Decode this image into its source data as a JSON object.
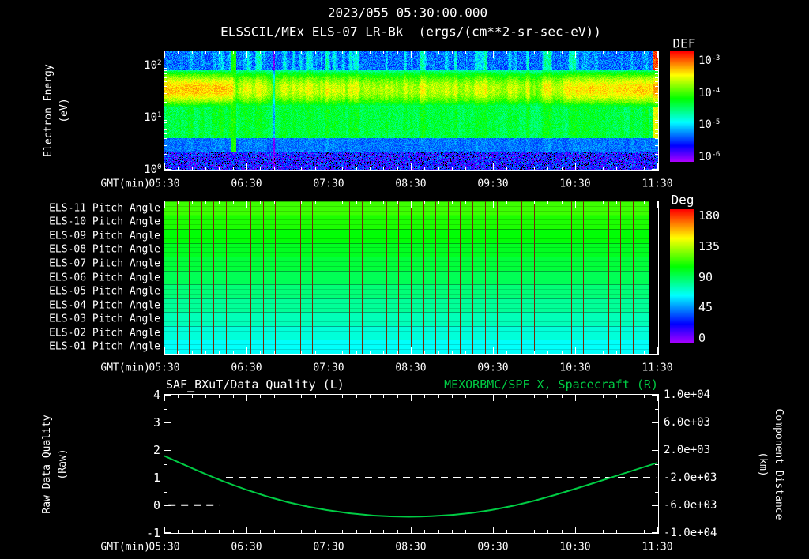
{
  "header": {
    "datetime": "2023/055 05:30:00.000",
    "instrument": "ELSSCIL/MEx ELS-07 LR-Bk",
    "units": "(ergs/(cm**2-sr-sec-eV))"
  },
  "colors": {
    "background": "#000000",
    "text": "#ffffff",
    "accent_green": "#00cc44",
    "grid_red": "#78280a",
    "frame": "#ffffff"
  },
  "time_axis": {
    "label": "GMT(min)",
    "ticks": [
      "05:30",
      "06:30",
      "07:30",
      "08:30",
      "09:30",
      "10:30",
      "11:30"
    ],
    "start": "05:30",
    "end": "11:30",
    "span_minutes": 360
  },
  "panel_energy": {
    "ylabel_line1": "Electron Energy",
    "ylabel_line2": "(eV)",
    "y_ticks": [
      {
        "base": "10",
        "exp": "2"
      },
      {
        "base": "10",
        "exp": "1"
      },
      {
        "base": "10",
        "exp": "0"
      }
    ],
    "colorbar": {
      "title": "DEF",
      "ticks": [
        {
          "base": "10",
          "exp": "-3"
        },
        {
          "base": "10",
          "exp": "-4"
        },
        {
          "base": "10",
          "exp": "-5"
        },
        {
          "base": "10",
          "exp": "-6"
        }
      ]
    }
  },
  "panel_pitch": {
    "row_labels": [
      "ELS-11 Pitch Angle",
      "ELS-10 Pitch Angle",
      "ELS-09 Pitch Angle",
      "ELS-08 Pitch Angle",
      "ELS-07 Pitch Angle",
      "ELS-06 Pitch Angle",
      "ELS-05 Pitch Angle",
      "ELS-04 Pitch Angle",
      "ELS-03 Pitch Angle",
      "ELS-02 Pitch Angle",
      "ELS-01 Pitch Angle"
    ],
    "colorbar": {
      "title": "Deg",
      "ticks": [
        "180",
        "135",
        "90",
        "45",
        "0"
      ]
    }
  },
  "panel_line": {
    "title_left": "SAF_BXuT/Data Quality (L)",
    "title_right": "MEXORBMC/SPF X, Spacecraft (R)",
    "ylabel_left_line1": "Raw Data Quality",
    "ylabel_left_line2": "(Raw)",
    "ylabel_right_line1": "Component Distance",
    "ylabel_right_line2": "(km)",
    "left_ticks": [
      "4",
      "3",
      "2",
      "1",
      "0",
      "-1"
    ],
    "right_ticks": [
      "1.0e+04",
      "6.0e+03",
      "2.0e+03",
      "-2.0e+03",
      "-6.0e+03",
      "-1.0e+04"
    ]
  },
  "chart_data": [
    {
      "type": "heatmap",
      "name": "electron_energy_spectrogram",
      "title": "ELSSCIL/MEx ELS-07 LR-Bk",
      "value_units": "ergs/(cm**2-sr-sec-eV)",
      "xlabel": "GMT(min)",
      "ylabel": "Electron Energy (eV)",
      "x_range": [
        "05:30",
        "11:30"
      ],
      "y_range_ev": [
        1,
        200
      ],
      "y_scale": "log",
      "color_scale_log10": [
        -6,
        -3
      ],
      "colorbar_label": "DEF",
      "bands": [
        {
          "energy_ev": [
            16,
            80
          ],
          "log10_flux": -3.6,
          "description": "bright yellow-green peak band"
        },
        {
          "energy_ev": [
            4,
            16
          ],
          "log10_flux": -4.6,
          "description": "green/cyan mottled flux"
        },
        {
          "energy_ev": [
            2.3,
            4
          ],
          "log10_flux": -5.3,
          "description": "dark blue band"
        },
        {
          "energy_ev": [
            1,
            2.3
          ],
          "log10_flux": -5.6,
          "description": "purple speckled background with black dropouts"
        },
        {
          "energy_ev": [
            80,
            200
          ],
          "log10_flux": -5.3,
          "description": "blue region with vertical green striations"
        }
      ],
      "time_features": [
        {
          "gmt": [
            "05:30",
            "06:20"
          ],
          "description": "intense yellow band 20-70 eV"
        },
        {
          "gmt": [
            "06:20",
            "10:20"
          ],
          "description": "variable flux, vertical green striations and dark gaps"
        },
        {
          "gmt": [
            "10:20",
            "11:30"
          ],
          "description": "band brightens again"
        },
        {
          "gmt": [
            "11:26",
            "11:30"
          ],
          "description": "intense full-height column, red above 100 eV"
        }
      ]
    },
    {
      "type": "heatmap",
      "name": "pitch_angle_panels",
      "xlabel": "GMT(min)",
      "rows": [
        "ELS-11",
        "ELS-10",
        "ELS-09",
        "ELS-08",
        "ELS-07",
        "ELS-06",
        "ELS-05",
        "ELS-04",
        "ELS-03",
        "ELS-02",
        "ELS-01"
      ],
      "row_pitch_angle_deg": [
        112,
        107,
        102,
        98,
        94,
        90,
        85,
        80,
        75,
        70,
        65
      ],
      "color_scale_deg": [
        0,
        180
      ],
      "colorbar_label": "Deg",
      "data_gap_t_min": [
        353,
        360
      ]
    },
    {
      "type": "line",
      "name": "data_quality_and_spacecraft_x",
      "xlabel": "GMT(min)",
      "left_axis": {
        "label": "Raw Data Quality (Raw)",
        "range": [
          -1,
          4
        ]
      },
      "right_axis": {
        "label": "Component Distance (km)",
        "range": [
          -10000,
          10000
        ]
      },
      "series": [
        {
          "name": "SAF_BXuT/Data Quality (L)",
          "axis": "left",
          "style": "dashed",
          "color": "#ffffff",
          "segments": [
            {
              "t_min": [
                3,
                40
              ],
              "value": 0
            },
            {
              "t_min": [
                45,
                359
              ],
              "value": 1
            }
          ]
        },
        {
          "name": "MEXORBMC/SPF X, Spacecraft (R)",
          "axis": "right",
          "style": "solid",
          "color": "#00cc44",
          "t_min": [
            0,
            30,
            60,
            90,
            120,
            150,
            180,
            210,
            240,
            270,
            300,
            330,
            360
          ],
          "km": [
            1100,
            -1600,
            -3900,
            -5700,
            -6900,
            -7600,
            -7820,
            -7550,
            -6800,
            -5500,
            -3700,
            -1800,
            100
          ]
        }
      ]
    }
  ]
}
